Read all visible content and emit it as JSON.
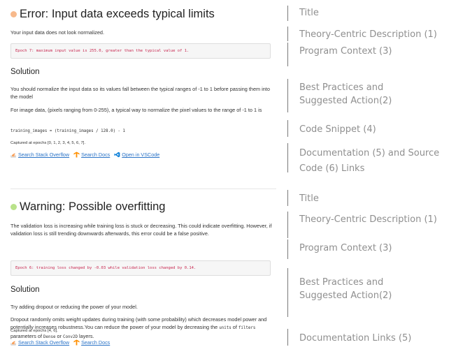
{
  "error_card": {
    "dot_color": "#f7b98c",
    "title": "Error: Input data exceeds typical limits",
    "description": "Your input data does not look normalized.",
    "context": "Epoch 7: maximum input value is 255.0, greater than the typical value of 1.",
    "solution_heading": "Solution",
    "solution_para1": "You should normalize the input data so its values fall between the typical ranges of -1 to 1 before passing them into the model",
    "solution_para2": "For image data, (pixels ranging from 0-255), a typical way to normalize the pixel values to the range of -1 to 1 is",
    "code_snippet": "training_images = (training_images / 128.0) - 1",
    "captured": "Captured at epochs [0, 1, 2, 3, 4, 5, 6, 7].",
    "links": [
      {
        "label": "Search Stack Overflow",
        "icon": "stack-overflow-icon"
      },
      {
        "label": "Search Docs",
        "icon": "tensorflow-icon"
      },
      {
        "label": "Open in VSCode",
        "icon": "vscode-icon"
      }
    ]
  },
  "warning_card": {
    "dot_color": "#b9e28a",
    "title": "Warning: Possible overfitting",
    "description": "The validation loss is increasing while training loss is stuck or decreasing. This could indicate overfitting. However, if validation loss is still trending downwards afterwards, this error could be a false positive.",
    "context": "Epoch 6: training loss changed by -0.03 while validation loss changed by 0.14.",
    "solution_heading": "Solution",
    "solution_para1": "Try adding dropout or reducing the power of your model.",
    "solution_para2_prefix": "Dropout randomly omits weight updates during training (with some probability) which decreases model power and potentially increases robustness.You can reduce the power of your model by decreasing the ",
    "code_units": "units",
    "text_of": " of ",
    "code_filters": "filters",
    "text_parameters_of": " parameters of ",
    "code_dense": "Dense",
    "text_or": " or ",
    "code_conv2d": "Conv2D",
    "text_layers": " layers.",
    "captured": "Captured at epochs [4, 6].",
    "links": [
      {
        "label": "Search Stack Overflow",
        "icon": "stack-overflow-icon"
      },
      {
        "label": "Search Docs",
        "icon": "tensorflow-icon"
      }
    ]
  },
  "annotations": [
    {
      "label": "Title"
    },
    {
      "label": "Theory-Centric Description (1)"
    },
    {
      "label": "Program Context (3)"
    },
    {
      "label": "Best Practices and"
    },
    {
      "label": "Suggested Action(2)"
    },
    {
      "label": "Code Snippet (4)"
    },
    {
      "label": "Documentation (5) and Source"
    },
    {
      "label": "Code (6) Links"
    },
    {
      "label": "Title"
    },
    {
      "label": "Theory-Centric Description (1)"
    },
    {
      "label": "Program Context (3)"
    },
    {
      "label": "Best Practices and"
    },
    {
      "label": "Suggested Action(2)"
    },
    {
      "label": "Documentation Links (5)"
    }
  ],
  "colors": {
    "link": "#2a73c7",
    "context_text": "#c7254e",
    "annotation_text": "#8f8f8f",
    "annotation_bar": "#7a7a7a"
  }
}
